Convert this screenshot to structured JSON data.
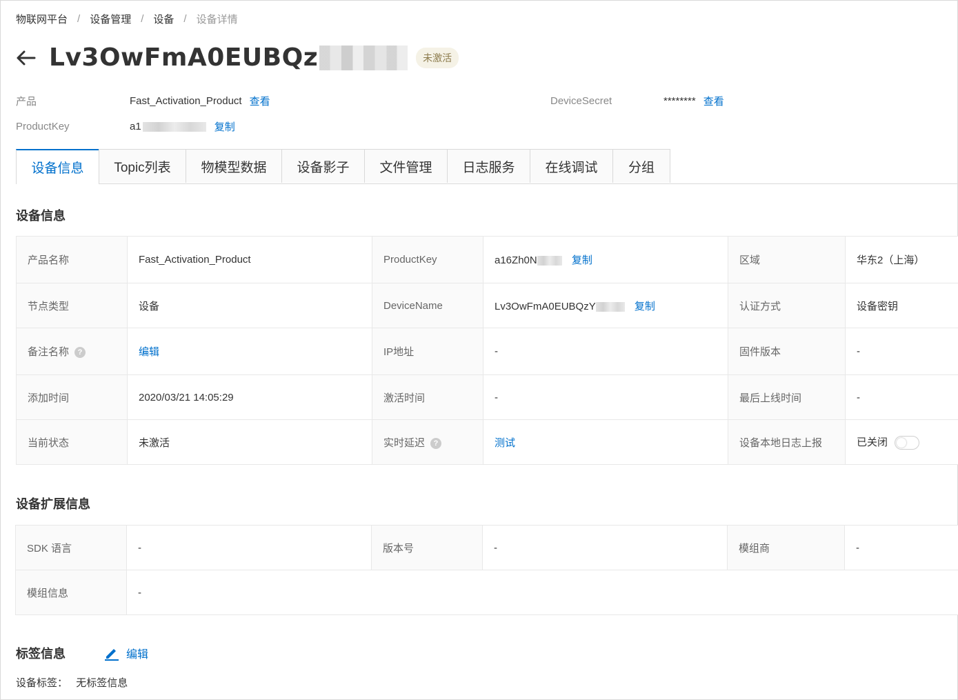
{
  "breadcrumb": [
    "物联网平台",
    "设备管理",
    "设备",
    "设备详情"
  ],
  "header": {
    "device_name": "Lv3OwFmA0EUBQz",
    "status": "未激活"
  },
  "meta": {
    "product_label": "产品",
    "product_value": "Fast_Activation_Product",
    "product_action": "查看",
    "productkey_label": "ProductKey",
    "productkey_value": "a1",
    "productkey_action": "复制",
    "secret_label": "DeviceSecret",
    "secret_value": "********",
    "secret_action": "查看"
  },
  "tabs": [
    "设备信息",
    "Topic列表",
    "物模型数据",
    "设备影子",
    "文件管理",
    "日志服务",
    "在线调试",
    "分组"
  ],
  "device_info": {
    "title": "设备信息",
    "rows": [
      [
        {
          "k": "产品名称",
          "v": "Fast_Activation_Product"
        },
        {
          "k": "ProductKey",
          "v": "a16Zh0N",
          "action": "复制"
        },
        {
          "k": "区域",
          "v": "华东2（上海）"
        }
      ],
      [
        {
          "k": "节点类型",
          "v": "设备"
        },
        {
          "k": "DeviceName",
          "v": "Lv3OwFmA0EUBQzY",
          "action": "复制"
        },
        {
          "k": "认证方式",
          "v": "设备密钥"
        }
      ],
      [
        {
          "k": "备注名称",
          "v": "编辑"
        },
        {
          "k": "IP地址",
          "v": "-"
        },
        {
          "k": "固件版本",
          "v": "-"
        }
      ],
      [
        {
          "k": "添加时间",
          "v": "2020/03/21 14:05:29"
        },
        {
          "k": "激活时间",
          "v": "-"
        },
        {
          "k": "最后上线时间",
          "v": "-"
        }
      ],
      [
        {
          "k": "当前状态",
          "v": "未激活"
        },
        {
          "k": "实时延迟",
          "v": "测试"
        },
        {
          "k": "设备本地日志上报",
          "v": "已关闭"
        }
      ]
    ]
  },
  "ext_info": {
    "title": "设备扩展信息",
    "rows": [
      [
        {
          "k": "SDK 语言",
          "v": "-"
        },
        {
          "k": "版本号",
          "v": "-"
        },
        {
          "k": "模组商",
          "v": "-"
        }
      ],
      [
        {
          "k": "模组信息",
          "v": "-"
        }
      ]
    ]
  },
  "tags": {
    "title": "标签信息",
    "edit": "编辑",
    "label": "设备标签：",
    "value": "无标签信息"
  },
  "colors": {
    "link": "#0070cc",
    "status_bg": "#f5f2e6",
    "status_text": "#8c7b4c"
  }
}
